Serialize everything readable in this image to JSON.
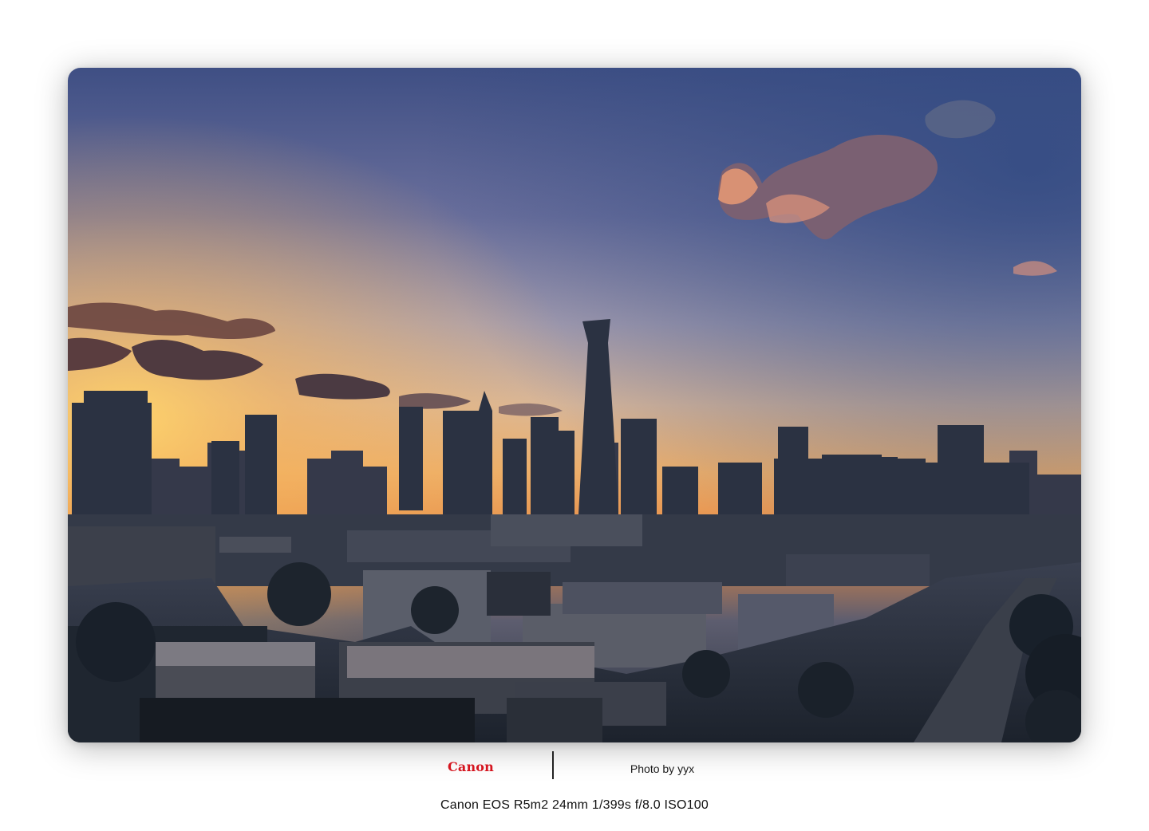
{
  "photo": {
    "subject": "city skyline at sunset",
    "sky_colors": {
      "top": "#3f4f84",
      "upper_mid": "#8a86a6",
      "mid": "#d9b99a",
      "horizon": "#f0a44a",
      "sun_glow": "#ffd15c"
    },
    "city_color": "#1f2733",
    "cloud_color": "#5a3f44",
    "cloud_highlight": "#e99a74"
  },
  "footer": {
    "brand_logo_text": "Canon",
    "credit": "Photo by yyx",
    "exif": "Canon EOS R5m2 24mm 1/399s f/8.0 ISO100",
    "brand_color": "#d5151f"
  }
}
